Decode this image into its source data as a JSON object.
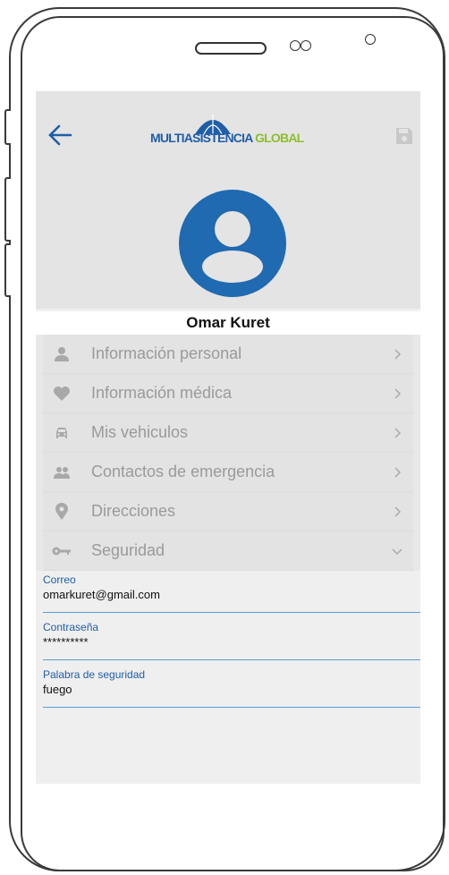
{
  "header": {
    "logo_part1": "MULTIASISTENCIA",
    "logo_part2": "GLOBAL",
    "colors": {
      "brand_blue": "#1f5ea8",
      "brand_green": "#8bbf2d",
      "avatar_blue": "#1f6ab0"
    }
  },
  "profile": {
    "name": "Omar Kuret"
  },
  "menu": [
    {
      "label": "Información personal",
      "icon": "person-icon"
    },
    {
      "label": "Información médica",
      "icon": "heart-icon"
    },
    {
      "label": "Mis vehiculos",
      "icon": "car-icon"
    },
    {
      "label": "Contactos de emergencia",
      "icon": "group-icon"
    },
    {
      "label": "Direcciones",
      "icon": "location-pin-icon"
    },
    {
      "label": "Seguridad",
      "icon": "key-icon"
    }
  ],
  "security": {
    "email_label": "Correo",
    "email_value": "omarkuret@gmail.com",
    "password_label": "Contraseña",
    "password_value": "**********",
    "word_label": "Palabra de seguridad",
    "word_value": "fuego"
  }
}
